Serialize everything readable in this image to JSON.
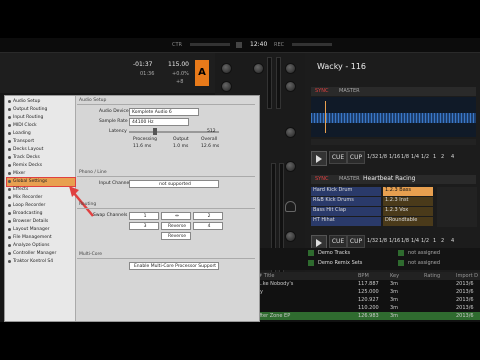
{
  "top_bar": {
    "cpu_label": "CTR",
    "time": "12:40",
    "rec_label": "REC"
  },
  "deck_a": {
    "time_remaining": "-01:37",
    "time_elapsed": "01:36",
    "bpm": "115.00",
    "pitch": "+0.0%",
    "pitch2": "+8",
    "letter": "A"
  },
  "deck_track": {
    "title": "Wacky - 116",
    "mode1": "SYNC",
    "mode2": "MASTER"
  },
  "transport": {
    "cue": "CUE",
    "cup": "CUP",
    "loop_sizes": [
      "1/32",
      "1/8",
      "1/16",
      "1/8",
      "1/4",
      "1/2",
      "1",
      "2",
      "4"
    ],
    "loop2_sizes": [
      "1/32",
      "1/8",
      "1/16",
      "1/8",
      "1/4",
      "1/2",
      "1",
      "2",
      "4"
    ]
  },
  "deck_c": {
    "title": "Heartbeat Racing",
    "mode1": "SYNC",
    "mode2": "MASTER",
    "slots": [
      "Hard Kick Drum",
      "R&B Kick Drums",
      "Bass Hit Clap",
      "HT Hihat"
    ],
    "slots2": [
      "1.2.3 Bass",
      "1.2.3 Inst",
      "1.2.3 Vox",
      "DRoundtable"
    ]
  },
  "preferences": {
    "categories": [
      {
        "label": "Audio Setup",
        "selected": false
      },
      {
        "label": "Output Routing",
        "selected": false
      },
      {
        "label": "Input Routing",
        "selected": false
      },
      {
        "label": "MIDI Clock",
        "selected": false
      },
      {
        "label": "Loading",
        "selected": false
      },
      {
        "label": "Transport",
        "selected": false
      },
      {
        "label": "Decks Layout",
        "selected": false
      },
      {
        "label": "Track Decks",
        "selected": false
      },
      {
        "label": "Remix Decks",
        "selected": false
      },
      {
        "label": "Mixer",
        "selected": false
      },
      {
        "label": "Global Settings",
        "selected": true
      },
      {
        "label": "Effects",
        "selected": false
      },
      {
        "label": "Mix Recorder",
        "selected": false
      },
      {
        "label": "Loop Recorder",
        "selected": false
      },
      {
        "label": "Broadcasting",
        "selected": false
      },
      {
        "label": "Browser Details",
        "selected": false
      },
      {
        "label": "Layout Manager",
        "selected": false
      },
      {
        "label": "File Management",
        "selected": false
      },
      {
        "label": "Analyze Options",
        "selected": false
      },
      {
        "label": "Controller Manager",
        "selected": false
      },
      {
        "label": "Traktor Kontrol S4",
        "selected": false
      }
    ],
    "audio_setup_heading": "Audio Setup",
    "audio_device_label": "Audio Device",
    "audio_device_value": "Komplete Audio 6",
    "sample_rate_label": "Sample Rate",
    "sample_rate_value": "44100 Hz",
    "latency_label": "Latency",
    "latency_value": "512",
    "processing_label": "Processing",
    "output_label": "Output",
    "overall_label": "Overall",
    "processing_value": "11.6 ms",
    "output_value": "1.0 ms",
    "overall_value": "12.6 ms",
    "phono_heading": "Phono / Line",
    "input_channel_label": "Input Channel",
    "input_channel_value": "not supported",
    "routing_heading": "Routing",
    "swap_channels_label": "Swap Channels",
    "swap_buttons": [
      "1",
      "2",
      "3",
      "4"
    ],
    "swap_arrows": [
      "⇔",
      "⇔"
    ],
    "swap_labels": [
      "Reverse",
      "Reverse"
    ],
    "multicore_heading": "Multi-Core",
    "multicore_button": "Enable Multi-Core Processor Support"
  },
  "browser": {
    "folders": [
      "Demo Tracks",
      "Demo Remix Sets"
    ],
    "assign_labels": [
      "not assigned",
      "not assigned"
    ],
    "headers": [
      "# Title",
      "BPM",
      "Key",
      "Rating",
      "Import D"
    ],
    "rows": [
      {
        "title": "...ke Nobody's",
        "bpm": "117.887",
        "key": "3m",
        "date": "2013/6"
      },
      {
        "title": "ty",
        "bpm": "125.000",
        "key": "3m",
        "date": "2013/6"
      },
      {
        "title": "",
        "bpm": "120.927",
        "key": "3m",
        "date": "2013/6"
      },
      {
        "title": "",
        "bpm": "110.200",
        "key": "3m",
        "date": "2013/6"
      },
      {
        "title": "ifter Zone EP",
        "bpm": "126.983",
        "key": "3m",
        "date": "2013/6"
      }
    ]
  },
  "colors": {
    "accent": "#e8a050",
    "deck_a_orange": "#e87a1a",
    "waveform_blue": "#3a78c8",
    "track_green": "#2f6b2f",
    "panel_bg": "#d6d6d6",
    "annotation_red": "#e04040"
  }
}
